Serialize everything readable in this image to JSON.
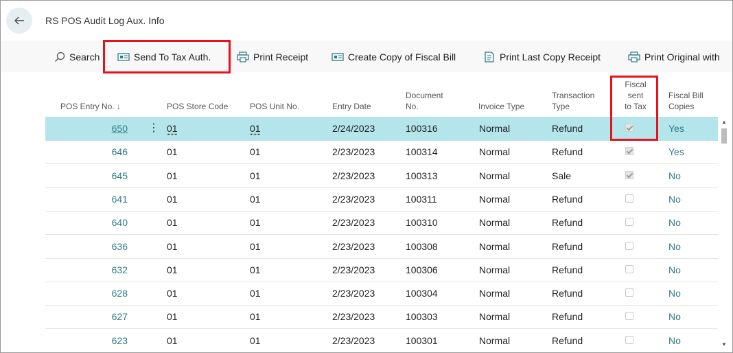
{
  "page": {
    "title": "RS POS Audit Log Aux. Info"
  },
  "actions": {
    "search": "Search",
    "send_to_tax": "Send To Tax Auth.",
    "print_receipt": "Print Receipt",
    "create_copy": "Create Copy of Fiscal Bill",
    "print_last_copy": "Print Last Copy Receipt",
    "print_original": "Print Original with"
  },
  "columns": {
    "entry_no": "POS Entry No. ↓",
    "store_code": "POS Store Code",
    "unit_no": "POS Unit No.",
    "entry_date": "Entry Date",
    "document_no": [
      "Document",
      "No."
    ],
    "invoice_type": "Invoice Type",
    "transaction_type": [
      "Transaction",
      "Type"
    ],
    "fiscal_sent": [
      "Fiscal",
      "sent",
      "to Tax"
    ],
    "fiscal_copies": [
      "Fiscal Bill",
      "Copies"
    ]
  },
  "colors": {
    "accent": "#2f7c86",
    "selected_row": "#b3e5ea",
    "highlight": "#e8101a"
  },
  "rows": [
    {
      "entry": "650",
      "store": "01",
      "unit": "01",
      "date": "2/24/2023",
      "doc": "100316",
      "invoice": "Normal",
      "trans": "Refund",
      "sent": true,
      "copies": "Yes"
    },
    {
      "entry": "646",
      "store": "01",
      "unit": "01",
      "date": "2/23/2023",
      "doc": "100314",
      "invoice": "Normal",
      "trans": "Refund",
      "sent": true,
      "copies": "Yes"
    },
    {
      "entry": "645",
      "store": "01",
      "unit": "01",
      "date": "2/23/2023",
      "doc": "100313",
      "invoice": "Normal",
      "trans": "Sale",
      "sent": true,
      "copies": "No"
    },
    {
      "entry": "641",
      "store": "01",
      "unit": "01",
      "date": "2/23/2023",
      "doc": "100311",
      "invoice": "Normal",
      "trans": "Refund",
      "sent": false,
      "copies": "No"
    },
    {
      "entry": "640",
      "store": "01",
      "unit": "01",
      "date": "2/23/2023",
      "doc": "100310",
      "invoice": "Normal",
      "trans": "Refund",
      "sent": false,
      "copies": "No"
    },
    {
      "entry": "636",
      "store": "01",
      "unit": "01",
      "date": "2/23/2023",
      "doc": "100308",
      "invoice": "Normal",
      "trans": "Refund",
      "sent": false,
      "copies": "No"
    },
    {
      "entry": "632",
      "store": "01",
      "unit": "01",
      "date": "2/23/2023",
      "doc": "100306",
      "invoice": "Normal",
      "trans": "Refund",
      "sent": false,
      "copies": "No"
    },
    {
      "entry": "628",
      "store": "01",
      "unit": "01",
      "date": "2/23/2023",
      "doc": "100304",
      "invoice": "Normal",
      "trans": "Refund",
      "sent": false,
      "copies": "No"
    },
    {
      "entry": "627",
      "store": "01",
      "unit": "01",
      "date": "2/23/2023",
      "doc": "100303",
      "invoice": "Normal",
      "trans": "Refund",
      "sent": false,
      "copies": "No"
    },
    {
      "entry": "623",
      "store": "01",
      "unit": "01",
      "date": "2/23/2023",
      "doc": "100301",
      "invoice": "Normal",
      "trans": "Refund",
      "sent": false,
      "copies": "No"
    }
  ]
}
